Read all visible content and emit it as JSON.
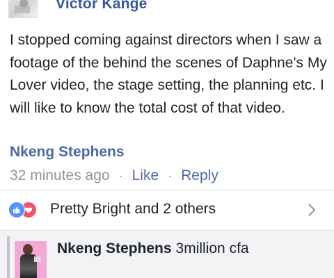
{
  "post": {
    "author": "Victor Kange"
  },
  "comment": {
    "text": "I stopped coming against directors when I saw a footage of the behind the scenes of Daphne's My Lover video, the stage setting, the planning etc. I will like to know the total cost of that video.",
    "author": "Nkeng Stephens",
    "timestamp": "32 minutes ago",
    "separator": "·",
    "like_label": "Like",
    "reply_label": "Reply"
  },
  "reactions": {
    "summary": "Pretty Bright and 2 others",
    "icons": [
      "like-icon",
      "love-icon"
    ],
    "colors": {
      "like": "#5890ff",
      "love": "#f25268"
    }
  },
  "reply_preview": {
    "author": "Nkeng Stephens",
    "text": "3million cfa"
  },
  "colors": {
    "link": "#4e69a2",
    "text": "#1d2129",
    "meta": "#90949c",
    "reply_bg": "#f2f3f5"
  }
}
